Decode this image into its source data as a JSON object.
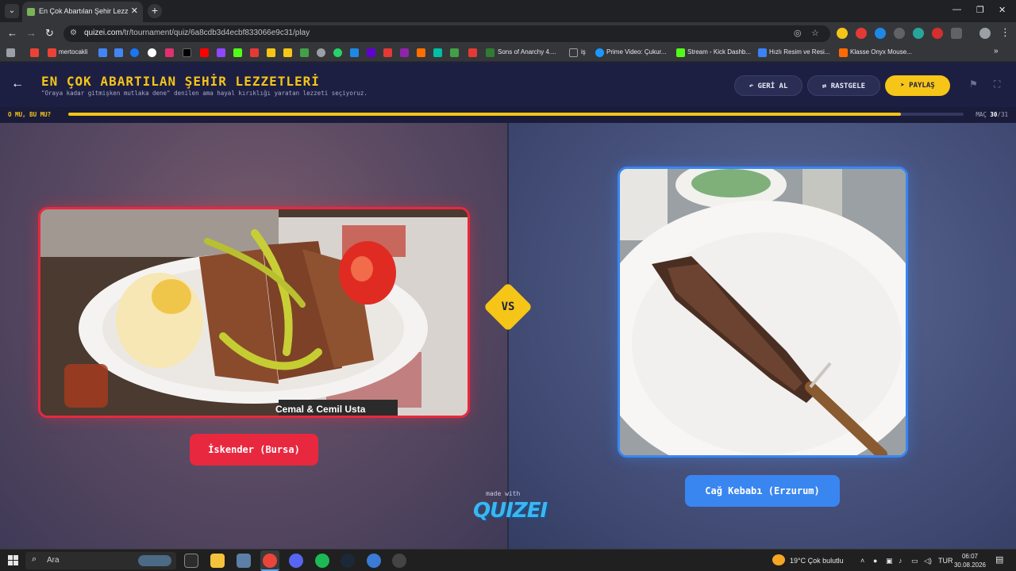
{
  "browser": {
    "tab_title": "En Çok Abartılan Şehir Lezzetleri",
    "url_host": "quizei.com",
    "url_path": "/tr/tournament/quiz/6a8cdb3d4ecbf833066e9c31/play",
    "bookmarks": [
      {
        "label": "mertocakli",
        "color": "#ea4335"
      },
      {
        "label": "Sons of Anarchy 4....",
        "color": "#2e7d32"
      },
      {
        "label": "iş",
        "color": "#9aa0a6"
      },
      {
        "label": "Prime Video: Çukur...",
        "color": "#1a98ff"
      },
      {
        "label": "Stream - Kick Dashb...",
        "color": "#53fc18"
      },
      {
        "label": "Hızlı Resim ve Resi...",
        "color": "#3b82f6"
      },
      {
        "label": "Klasse Onyx Mouse...",
        "color": "#ff6a00"
      }
    ]
  },
  "header": {
    "title": "EN ÇOK ABARTILAN ŞEHİR LEZZETLERİ",
    "subtitle": "\"Oraya kadar gitmişken mutlaka dene\" denilen ama hayal kırıklığı yaratan lezzeti seçiyoruz.",
    "undo_label": "GERİ AL",
    "random_label": "RASTGELE",
    "share_label": "PAYLAŞ"
  },
  "progress": {
    "label": "O MU, BU MU?",
    "match_prefix": "MAÇ",
    "current": "30",
    "total": "/31",
    "fraction": 0.93
  },
  "match": {
    "left": {
      "name": "İskender (Bursa)",
      "accent": "#e8283f"
    },
    "vs": "VS",
    "right": {
      "name": "Cağ Kebabı (Erzurum)",
      "accent": "#3a86f0"
    },
    "made_with": "made with",
    "brand": "QUIZEI"
  },
  "taskbar": {
    "search_placeholder": "Ara",
    "weather": "19°C  Çok bulutlu",
    "lang": "TUR",
    "time": "06:07",
    "date": "30.08.2026"
  },
  "colors": {
    "accent_yellow": "#f5c518",
    "header_bg": "#1d1f42"
  }
}
